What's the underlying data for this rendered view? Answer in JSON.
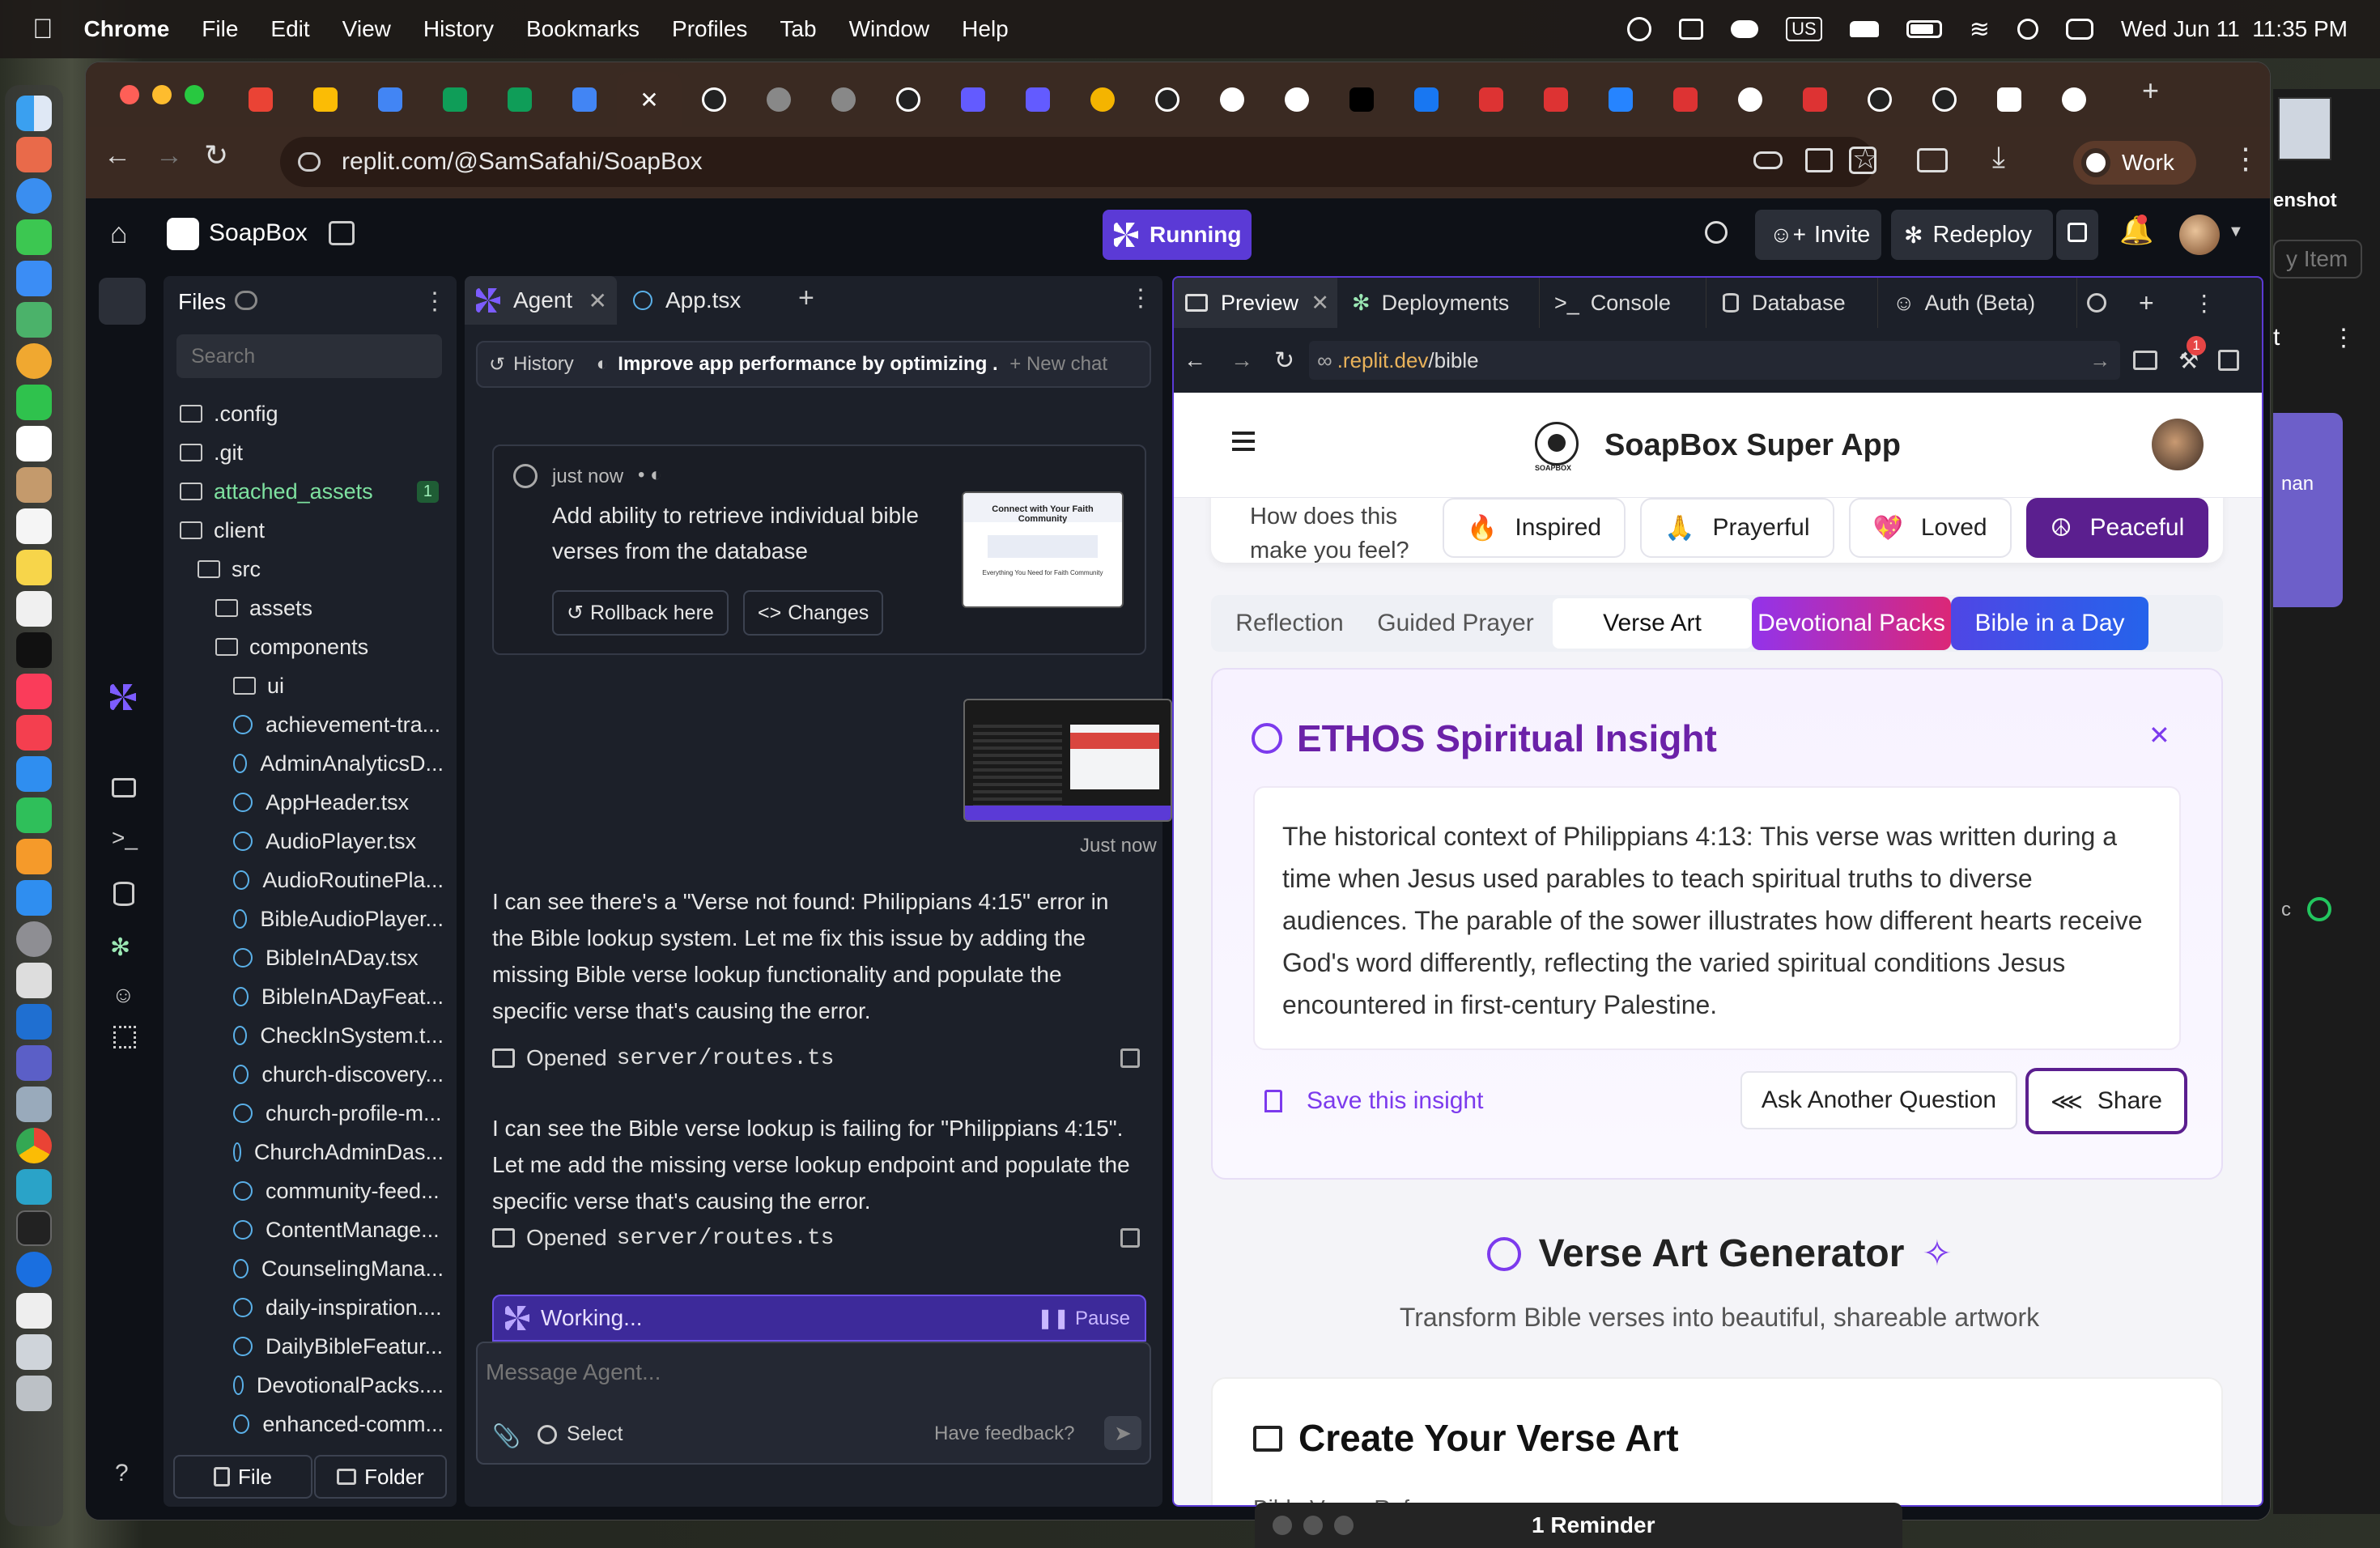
{
  "menubar": {
    "app": "Chrome",
    "menus": [
      "File",
      "Edit",
      "View",
      "History",
      "Bookmarks",
      "Profiles",
      "Tab",
      "Window",
      "Help"
    ],
    "datetime": "Wed Jun 11  11:35 PM",
    "status_icons": [
      "password-icon",
      "screen-icon",
      "cloud-icon",
      "keyboard-layout-icon",
      "car-icon",
      "battery-icon",
      "wifi-icon",
      "search-icon",
      "control-center-icon"
    ],
    "keyboard_layout": "US"
  },
  "browser": {
    "url_host": "replit.com",
    "url_path": "/@SamSafahi/SoapBox",
    "profile_label": "Work",
    "tabs": [
      "gmail",
      "drive",
      "docs",
      "sheets",
      "sheets",
      "docs",
      "active",
      "openai",
      "globe",
      "globe",
      "openai",
      "stripe",
      "stripe",
      "chrome",
      "openai",
      "google",
      "google",
      "x",
      "facebook",
      "app",
      "app",
      "jira",
      "app",
      "google",
      "app",
      "openai",
      "openai",
      "github",
      "google"
    ]
  },
  "replit": {
    "project_name": "SoapBox",
    "run_status": "Running",
    "invite_label": "Invite",
    "redeploy_label": "Redeploy",
    "notification_count": ""
  },
  "files": {
    "title": "Files",
    "search_placeholder": "Search",
    "items": [
      {
        "name": ".config",
        "type": "folder",
        "level": 0
      },
      {
        "name": ".git",
        "type": "folder",
        "level": 0
      },
      {
        "name": "attached_assets",
        "type": "folder",
        "level": 0,
        "badge": "1"
      },
      {
        "name": "client",
        "type": "folder-open",
        "level": 0
      },
      {
        "name": "src",
        "type": "folder-open",
        "level": 1
      },
      {
        "name": "assets",
        "type": "folder",
        "level": 2
      },
      {
        "name": "components",
        "type": "folder-open",
        "level": 2
      },
      {
        "name": "ui",
        "type": "folder",
        "level": 3
      },
      {
        "name": "achievement-tra...",
        "type": "file",
        "level": 3
      },
      {
        "name": "AdminAnalyticsD...",
        "type": "file",
        "level": 3
      },
      {
        "name": "AppHeader.tsx",
        "type": "file",
        "level": 3
      },
      {
        "name": "AudioPlayer.tsx",
        "type": "file",
        "level": 3
      },
      {
        "name": "AudioRoutinePla...",
        "type": "file",
        "level": 3
      },
      {
        "name": "BibleAudioPlayer...",
        "type": "file",
        "level": 3
      },
      {
        "name": "BibleInADay.tsx",
        "type": "file",
        "level": 3
      },
      {
        "name": "BibleInADayFeat...",
        "type": "file",
        "level": 3
      },
      {
        "name": "CheckInSystem.t...",
        "type": "file",
        "level": 3
      },
      {
        "name": "church-discovery...",
        "type": "file",
        "level": 3
      },
      {
        "name": "church-profile-m...",
        "type": "file",
        "level": 3
      },
      {
        "name": "ChurchAdminDas...",
        "type": "file",
        "level": 3
      },
      {
        "name": "community-feed...",
        "type": "file",
        "level": 3
      },
      {
        "name": "ContentManage...",
        "type": "file",
        "level": 3
      },
      {
        "name": "CounselingMana...",
        "type": "file",
        "level": 3
      },
      {
        "name": "daily-inspiration....",
        "type": "file",
        "level": 3
      },
      {
        "name": "DailyBibleFeatur...",
        "type": "file",
        "level": 3
      },
      {
        "name": "DevotionalPacks....",
        "type": "file",
        "level": 3
      },
      {
        "name": "enhanced-comm...",
        "type": "file",
        "level": 3
      }
    ],
    "new_file": "File",
    "new_folder": "Folder"
  },
  "agent": {
    "tab_agent": "Agent",
    "tab_file": "App.tsx",
    "history": "History",
    "thread_title": "Improve app performance by optimizing ...",
    "new_chat": "New chat",
    "checkpoint_time": "just now",
    "checkpoint_text": "Add ability to retrieve individual bible verses from the database",
    "rollback": "Rollback here",
    "changes": "Changes",
    "thumb_title": "Connect with Your Faith Community",
    "thumb_sub": "Everything You Need for Faith Community",
    "user_time": "Just now",
    "msg1": "I can see there's a \"Verse not found: Philippians 4:15\" error in the Bible lookup system. Let me fix this issue by adding the missing Bible verse lookup functionality and populate the specific verse that's causing the error.",
    "opened_label": "Opened",
    "opened_file": "server/routes.ts",
    "msg2": "I can see the Bible verse lookup is failing for \"Philippians 4:15\". Let me add the missing verse lookup endpoint and populate the specific verse that's causing the error.",
    "working": "Working...",
    "pause": "Pause",
    "input_placeholder": "Message Agent...",
    "select": "Select",
    "feedback": "Have feedback?"
  },
  "preview": {
    "tabs": [
      "Preview",
      "Deployments",
      "Console",
      "Database",
      "Auth (Beta)"
    ],
    "url_host": ".replit.dev",
    "url_path": "/bible",
    "devtools_badge": "1",
    "app_title": "SoapBox Super App",
    "logo_text": "SOAPBOX",
    "feel_question": "How does this make you feel?",
    "moods": [
      {
        "emoji": "🔥",
        "label": "Inspired"
      },
      {
        "emoji": "🙏",
        "label": "Prayerful"
      },
      {
        "emoji": "💖",
        "label": "Loved"
      },
      {
        "emoji": "☮",
        "label": "Peaceful"
      }
    ],
    "subtabs": [
      "Reflection",
      "Guided Prayer",
      "Verse Art",
      "Devotional Packs",
      "Bible in a Day"
    ],
    "insight_title": "ETHOS Spiritual Insight",
    "insight_text": "The historical context of Philippians 4:13: This verse was written during a time when Jesus used parables to teach spiritual truths to diverse audiences. The parable of the sower illustrates how different hearts receive God's word differently, reflecting the varied spiritual conditions Jesus encountered in first-century Palestine.",
    "save_insight": "Save this insight",
    "ask_another": "Ask Another Question",
    "share": "Share",
    "verse_art_title": "Verse Art Generator",
    "verse_art_sub": "Transform Bible verses into beautiful, shareable artwork",
    "create_title": "Create Your Verse Art",
    "next_label": "Bible Verse Reference"
  },
  "reminder": "1 Reminder",
  "side_window": {
    "label1": "enshot",
    "label2": "y Item",
    "label3": "t",
    "label4": "nan",
    "label5": "c"
  },
  "colors": {
    "replit_purple": "#5b3ad6",
    "app_purple": "#6b21a8",
    "agent_green": "#4ade80",
    "accent_devotional": "#a21caf",
    "accent_bible": "#4338ca"
  }
}
